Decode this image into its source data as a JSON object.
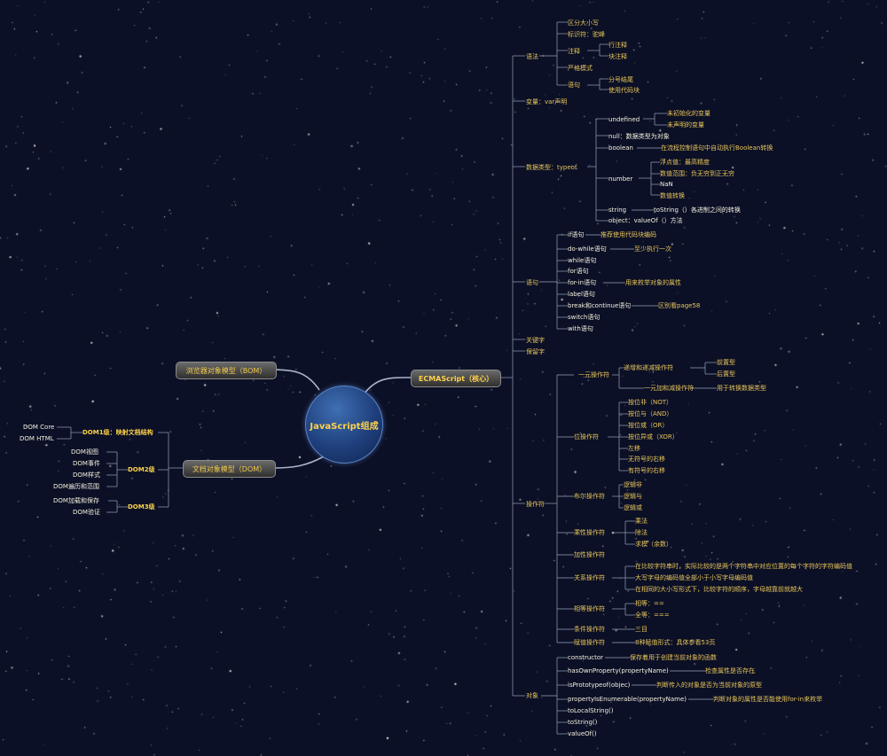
{
  "center": {
    "title": "JavaScript组成"
  },
  "bom": {
    "label": "浏览器对象模型（BOM）"
  },
  "dom": {
    "label": "文档对象模型（DOM）",
    "levels": [
      {
        "name": "DOM1级：映射文档结构",
        "items": [
          "DOM Core",
          "DOM HTML"
        ]
      },
      {
        "name": "DOM2级",
        "items": [
          "DOM视图",
          "DOM事件",
          "DOM样式",
          "DOM遍历和范围"
        ]
      },
      {
        "name": "DOM3级",
        "items": [
          "DOM加载和保存",
          "DOM验证"
        ]
      }
    ]
  },
  "ecma": {
    "label": "ECMAScript（核心）",
    "syntax": {
      "name": "语法",
      "items": [
        "区分大小写",
        "标识符：驼峰",
        "注释",
        "严格模式",
        "语句"
      ],
      "comments": [
        "行注释",
        "块注释"
      ],
      "statements": [
        "分号结尾",
        "使用代码块"
      ]
    },
    "variables": {
      "name": "变量：var声明"
    },
    "types": {
      "name": "数据类型：typeof",
      "undefined": "undefined",
      "undefined_sub": [
        "未初始化的变量",
        "未声明的变量"
      ],
      "null": "null：数据类型为对象",
      "boolean": "boolean",
      "boolean_sub": "在流程控制语句中自动执行Boolean转换",
      "number": "number",
      "number_sub": [
        "浮点值：最高精度",
        "数值范围：负无穷到正无穷",
        "NaN",
        "数值转换"
      ],
      "string": "string",
      "string_sub": "toString（）各进制之间的转换",
      "object": "object：valueOf（）方法"
    },
    "statements": {
      "name": "语句",
      "items": [
        "if语句",
        "do-while语句",
        "while语句",
        "for语句",
        "for-in语句",
        "label语句",
        "break和continue语句",
        "switch语句",
        "with语句"
      ],
      "if_note": "推荐使用代码块编码",
      "dowhile_note": "至少执行一次",
      "forin_note": "用来枚举对象的属性",
      "break_note": "区别看page58"
    },
    "keywords": "关键字",
    "reserved": "保留字",
    "operators": {
      "name": "操作符",
      "unary": {
        "name": "一元操作符",
        "inc": "递增和递减操作符",
        "inc_sub": [
          "前置型",
          "后置型"
        ],
        "plus": "一元加和减操作符",
        "plus_sub": "用于转换数据类型"
      },
      "bitwise": {
        "name": "位操作符",
        "items": [
          "按位非（NOT）",
          "按位与（AND）",
          "按位或（OR）",
          "按位异或（XOR）",
          "左移",
          "无符号的右移",
          "有符号的右移"
        ]
      },
      "boolean": {
        "name": "布尔操作符",
        "items": [
          "逻辑非",
          "逻辑与",
          "逻辑或"
        ]
      },
      "multiplicative": {
        "name": "乘性操作符",
        "items": [
          "乘法",
          "除法",
          "求模（余数）"
        ]
      },
      "additive": {
        "name": "加性操作符"
      },
      "relational": {
        "name": "关系操作符",
        "items": [
          "在比较字符串时，实际比较的是两个字符串中对应位置的每个字符的字符编码值",
          "大写字母的编码值全部小于小写字母编码值",
          "在相同的大小写形式下，比较字符的顺序，字母越靠前就越大"
        ]
      },
      "equality": {
        "name": "相等操作符",
        "items": [
          "相等：==",
          "全等：==="
        ]
      },
      "conditional": {
        "name": "条件操作符",
        "note": "三目"
      },
      "assignment": {
        "name": "赋值操作符",
        "note": "8种赋值形式：具体参看53页"
      }
    },
    "objects": {
      "name": "对象",
      "items": [
        "constructor",
        "hasOwnProperty(propertyName)",
        "isPrototypeof(objec)",
        "propertyIsEnumerable(propertyName)",
        "toLocalString()",
        "toString()",
        "valueOf()"
      ],
      "notes": [
        "保存着用于创建当前对象的函数",
        "检查属性是否存在",
        "判断传入的对象是否为当前对象的原型",
        "判断对象的属性是否能使用for-in来枚举"
      ]
    }
  }
}
